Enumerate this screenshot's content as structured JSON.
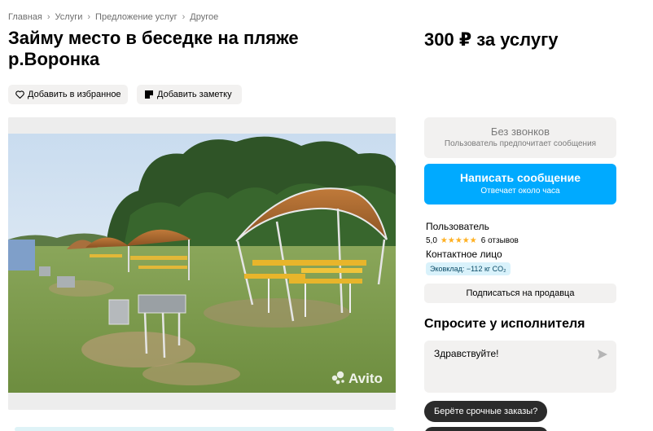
{
  "breadcrumbs": [
    "Главная",
    "Услуги",
    "Предложение услуг",
    "Другое"
  ],
  "title": "Займу место в беседке на пляже р.Воронка",
  "price": "300 ₽ за услугу",
  "actions": {
    "favorite_label": "Добавить в избранное",
    "note_label": "Добавить заметку"
  },
  "gallery": {
    "watermark": "Avito"
  },
  "contact_panel": {
    "no_calls_title": "Без звонков",
    "no_calls_subtitle": "Пользователь предпочитает сообщения",
    "message_button_title": "Написать сообщение",
    "message_button_subtitle": "Отвечает около часа"
  },
  "seller": {
    "name": "Пользователь",
    "rating": "5,0",
    "rating_stars": 5,
    "reviews": "6 отзывов",
    "contact_person": "Контактное лицо",
    "eco_badge": "Эковклад: −112 кг CO₂",
    "subscribe_label": "Подписаться на продавца"
  },
  "ask": {
    "title": "Спросите у исполнителя",
    "message_text": "Здравствуйте!",
    "quick_reply_1": "Берёте срочные заказы?"
  },
  "colors": {
    "accent": "#00aaff",
    "star": "#ffb021",
    "chip_bg": "#f2f1f0",
    "dark_chip": "#2b2b2b"
  }
}
